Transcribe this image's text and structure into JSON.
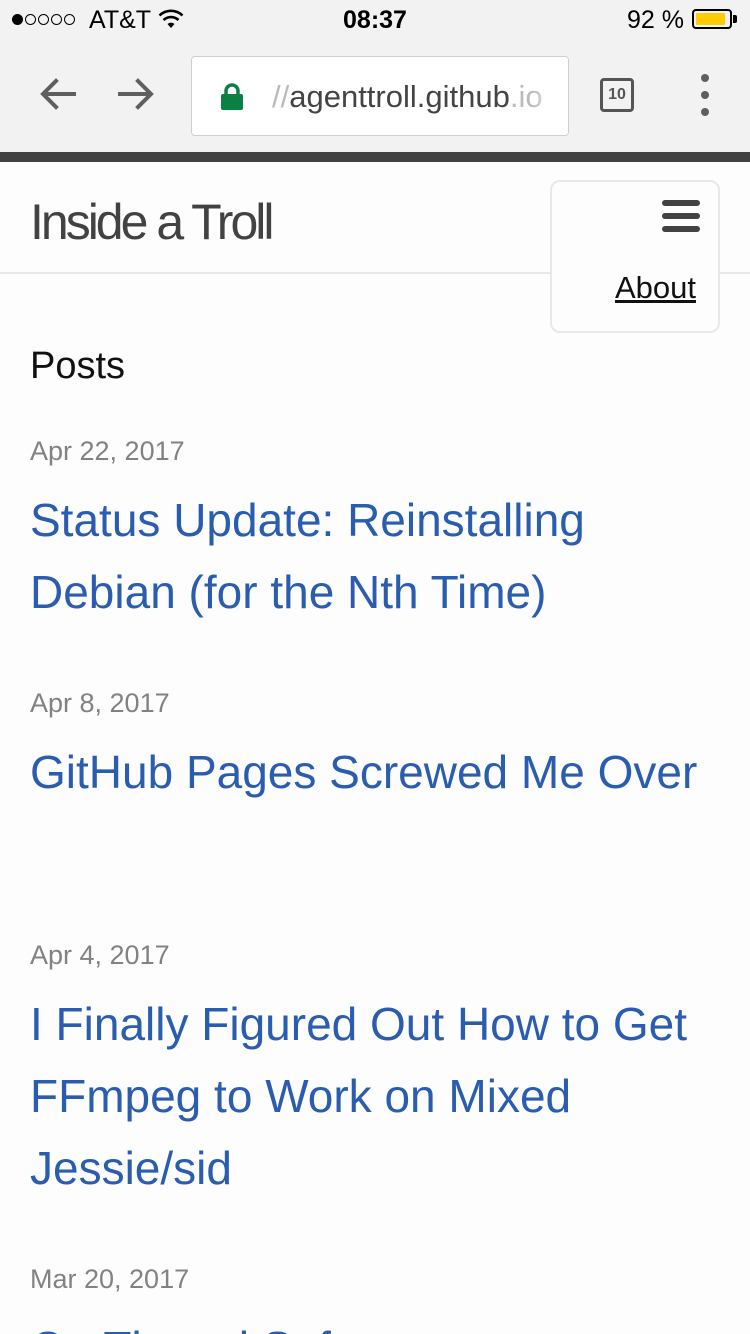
{
  "status_bar": {
    "carrier": "AT&T",
    "time": "08:37",
    "battery_percent": "92 %",
    "battery_level": 0.92,
    "signal_bars": 1,
    "signal_max": 5
  },
  "browser": {
    "url_prefix": "//",
    "url_host": "agenttroll.github",
    "url_suffix": ".io",
    "tab_count": "10",
    "secure": true
  },
  "site": {
    "title": "Inside a Troll",
    "menu": {
      "about_label": "About"
    }
  },
  "posts": {
    "heading": "Posts",
    "items": [
      {
        "date": "Apr 22, 2017",
        "title": "Status Update: Reinstalling Debian (for the Nth Time)"
      },
      {
        "date": "Apr 8, 2017",
        "title": "GitHub Pages Screwed Me Over"
      },
      {
        "date": "Apr 4, 2017",
        "title": "I Finally Figured Out How to Get FFmpeg to Work on Mixed Jessie/sid"
      },
      {
        "date": "Mar 20, 2017",
        "title": "On Thread Safety"
      }
    ]
  },
  "colors": {
    "link": "#2a5db0",
    "date": "#828282",
    "lock": "#0b8043",
    "battery": "#ffcc00",
    "divider": "#424242"
  }
}
